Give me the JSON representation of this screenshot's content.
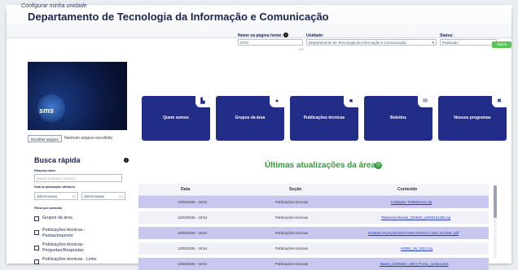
{
  "header": {
    "configure_link": "Configurar minha unidade",
    "title": "Departamento de Tecnologia da Informação e Comunicação"
  },
  "form": {
    "home_name_label": "Nome na página home:",
    "home_name_value": "DTIC",
    "home_name_counter": "4/8",
    "unit_label": "Unidade:",
    "unit_value": "Departamento de Tecnologia da Informação e Comunicação",
    "status_label": "Status:",
    "status_value": "Publicado",
    "save_label": "Salvar"
  },
  "logo": {
    "text": "sms"
  },
  "file_input": {
    "button_label": "Escolher arquivo",
    "status_text": "Nenhum arquivo escolhido"
  },
  "tiles": [
    {
      "label": "Quem somos",
      "icon": "document-icon",
      "glyph": "▙"
    },
    {
      "label": "Grupos da área",
      "icon": "group-icon",
      "glyph": "●"
    },
    {
      "label": "Publicações técnicas",
      "icon": "book-icon",
      "glyph": "■"
    },
    {
      "label": "Boletins",
      "icon": "mail-icon",
      "glyph": "✉"
    },
    {
      "label": "Nossos programas",
      "icon": "tools-icon",
      "glyph": "✖"
    }
  ],
  "busca": {
    "title": "Busca rápida",
    "keyword_label": "Palavras-chave",
    "keyword_placeholder": "Busca (máximo 3 itens)",
    "date_label": "Data de publicação: Mês/Ano",
    "date_from_placeholder": "dd/mm/aaaa",
    "date_to_placeholder": "dd/mm/aaaa",
    "filter_label": "Filtrar por conteúdo",
    "filters": [
      "Grupos da área",
      "Publicações técnicas - Pastas/arquivos",
      "Publicações técnicas - Perguntas/Respostas",
      "Publicações técnicas - Links"
    ]
  },
  "updates": {
    "title": "Últimas atualizações da área",
    "columns": [
      "Data",
      "Seção",
      "Conteúdo"
    ],
    "rows": [
      {
        "date": "13/03/2026 - 15:54",
        "section": "Publicações técnicas",
        "content": "Instalador TABWIN415.zip"
      },
      {
        "date": "13/03/2026 - 15:54",
        "section": "Publicações técnicas",
        "content": "Tabelas/unificada_202605_p2005151335.zip"
      },
      {
        "date": "13/03/2026 - 15:54",
        "section": "Publicações técnicas",
        "content": "DADOS ATUALIZADOS PARA ENVIO À SEC SAÚDE .pdf"
      },
      {
        "date": "13/03/2026 - 15:54",
        "section": "Publicações técnicas",
        "content": "H0001_06_2023.csv"
      },
      {
        "date": "13/03/2026 - 15:54",
        "section": "Publicações técnicas",
        "content": "Tabela_CIDEEEE_2024_Ponto_contato.xlsx"
      }
    ]
  },
  "colors": {
    "tile": "#222d88",
    "accent_green": "#2f9d3a",
    "row_highlight": "#c7c7f0"
  }
}
